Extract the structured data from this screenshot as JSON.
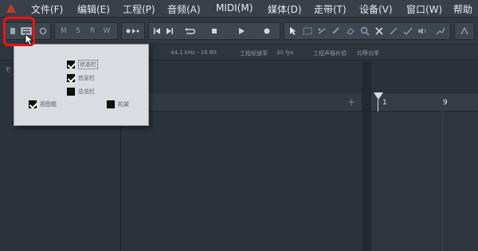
{
  "menubar": {
    "items": [
      "文件(F)",
      "编辑(E)",
      "工程(P)",
      "音频(A)",
      "MIDI(M)",
      "媒体(D)",
      "走带(T)",
      "设备(V)",
      "窗口(W)",
      "帮助"
    ]
  },
  "toolbar": {
    "mode_buttons": [
      "M",
      "S",
      "R",
      "W"
    ]
  },
  "infobar": {
    "sample_rate": "44.1 kHz - 16 Bit",
    "frame_rate_label": "工程帧速率",
    "frame_rate": "30 fps",
    "pan_law_label": "工程声像补偿",
    "pan_law": "均等功率"
  },
  "popup": {
    "options": [
      {
        "label": "状态栏",
        "checked": true
      },
      {
        "label": "信息栏",
        "checked": true
      },
      {
        "label": "总览栏",
        "checked": false
      },
      {
        "label": "视图框",
        "checked": true
      },
      {
        "label": "机架",
        "checked": false
      }
    ]
  },
  "ruler": {
    "marks": [
      "1",
      "9"
    ]
  },
  "colors": {
    "highlight": "#e8141a",
    "menubar_bg": "#39404a",
    "panel_bg": "#2d333b",
    "popup_bg": "#d9dce0"
  }
}
